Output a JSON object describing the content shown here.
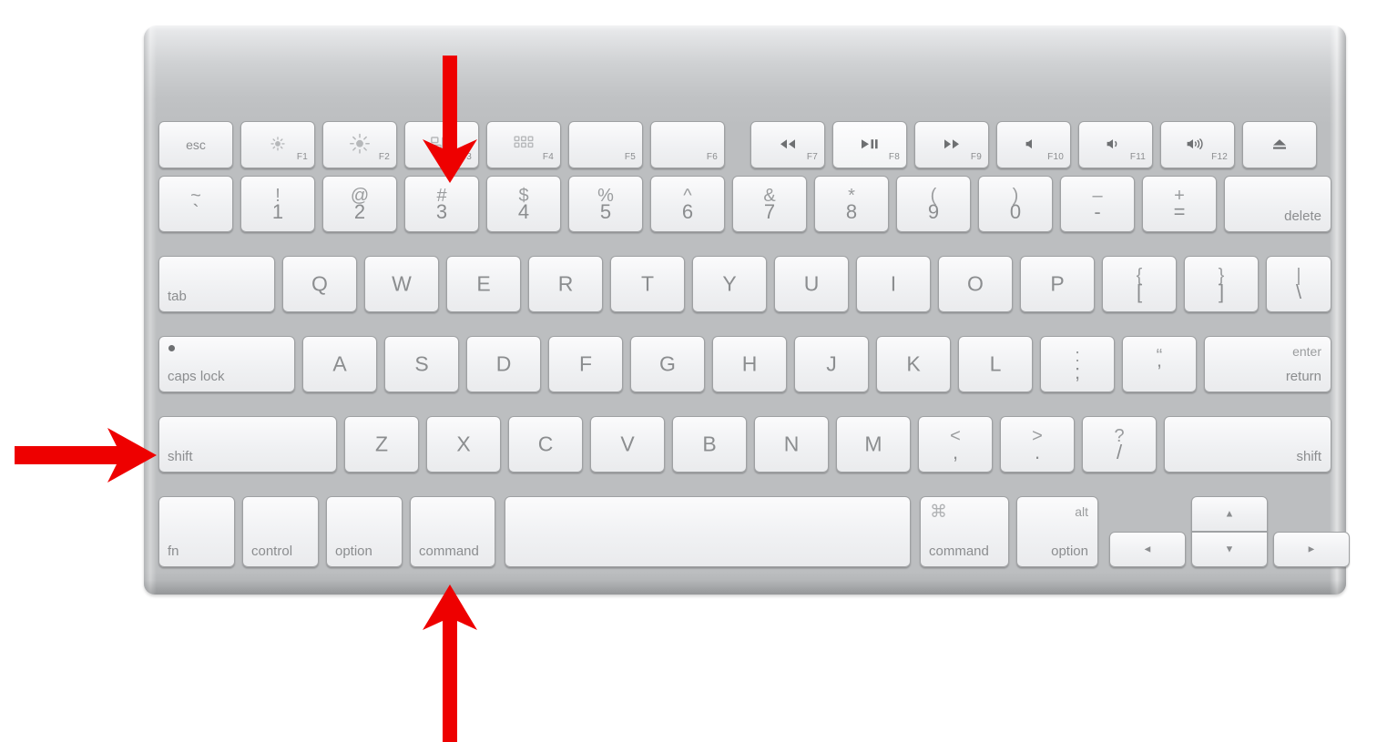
{
  "device": {
    "name": "apple-wireless-keyboard",
    "body_color": "#bcbec0",
    "key_color": "#f2f3f5",
    "legend_color": "#8b8d8f",
    "annotation_color": "#ee0000"
  },
  "rows": {
    "function_row": [
      {
        "name": "esc",
        "label": "esc",
        "kind": "word-center"
      },
      {
        "name": "f1",
        "fkey": "F1",
        "icon": "brightness-down-icon",
        "kind": "fkey"
      },
      {
        "name": "f2",
        "fkey": "F2",
        "icon": "brightness-up-icon",
        "kind": "fkey"
      },
      {
        "name": "f3",
        "fkey": "F3",
        "icon": "mission-control-icon",
        "kind": "fkey"
      },
      {
        "name": "f4",
        "fkey": "F4",
        "icon": "launchpad-icon",
        "kind": "fkey"
      },
      {
        "name": "f5",
        "fkey": "F5",
        "icon": "none",
        "kind": "fkey"
      },
      {
        "name": "f6",
        "fkey": "F6",
        "icon": "none",
        "kind": "fkey"
      },
      {
        "name": "f7",
        "fkey": "F7",
        "icon": "rewind-icon",
        "kind": "fkey"
      },
      {
        "name": "f8",
        "fkey": "F8",
        "icon": "play-pause-icon",
        "kind": "fkey"
      },
      {
        "name": "f9",
        "fkey": "F9",
        "icon": "fast-forward-icon",
        "kind": "fkey"
      },
      {
        "name": "f10",
        "fkey": "F10",
        "icon": "mute-icon",
        "kind": "fkey"
      },
      {
        "name": "f11",
        "fkey": "F11",
        "icon": "volume-down-icon",
        "kind": "fkey"
      },
      {
        "name": "f12",
        "fkey": "F12",
        "icon": "volume-up-icon",
        "kind": "fkey"
      },
      {
        "name": "eject",
        "fkey": "",
        "icon": "eject-icon",
        "kind": "fkey"
      }
    ],
    "number_row": [
      {
        "name": "backtick",
        "upper": "~",
        "lower": "`"
      },
      {
        "name": "one",
        "upper": "!",
        "lower": "1"
      },
      {
        "name": "two",
        "upper": "@",
        "lower": "2"
      },
      {
        "name": "three",
        "upper": "#",
        "lower": "3"
      },
      {
        "name": "four",
        "upper": "$",
        "lower": "4"
      },
      {
        "name": "five",
        "upper": "%",
        "lower": "5"
      },
      {
        "name": "six",
        "upper": "^",
        "lower": "6"
      },
      {
        "name": "seven",
        "upper": "&",
        "lower": "7"
      },
      {
        "name": "eight",
        "upper": "*",
        "lower": "8"
      },
      {
        "name": "nine",
        "upper": "(",
        "lower": "9"
      },
      {
        "name": "zero",
        "upper": ")",
        "lower": "0"
      },
      {
        "name": "minus",
        "upper": "–",
        "lower": "-"
      },
      {
        "name": "equals",
        "upper": "+",
        "lower": "="
      },
      {
        "name": "delete",
        "label": "delete",
        "kind": "word-bottom-right"
      }
    ],
    "top_letter_row": [
      {
        "name": "tab",
        "label": "tab",
        "kind": "word-bottom-left"
      },
      {
        "name": "q",
        "label": "Q"
      },
      {
        "name": "w",
        "label": "W"
      },
      {
        "name": "e",
        "label": "E"
      },
      {
        "name": "r",
        "label": "R"
      },
      {
        "name": "t",
        "label": "T"
      },
      {
        "name": "y",
        "label": "Y"
      },
      {
        "name": "u",
        "label": "U"
      },
      {
        "name": "i",
        "label": "I"
      },
      {
        "name": "o",
        "label": "O"
      },
      {
        "name": "p",
        "label": "P"
      },
      {
        "name": "left-bracket",
        "upper": "{",
        "lower": "["
      },
      {
        "name": "right-bracket",
        "upper": "}",
        "lower": "]"
      },
      {
        "name": "backslash",
        "upper": "|",
        "lower": "\\"
      }
    ],
    "home_row": [
      {
        "name": "caps-lock",
        "label": "caps lock",
        "kind": "word-bottom-left",
        "indicator": true
      },
      {
        "name": "a",
        "label": "A"
      },
      {
        "name": "s",
        "label": "S"
      },
      {
        "name": "d",
        "label": "D"
      },
      {
        "name": "f",
        "label": "F"
      },
      {
        "name": "g",
        "label": "G"
      },
      {
        "name": "h",
        "label": "H"
      },
      {
        "name": "j",
        "label": "J"
      },
      {
        "name": "k",
        "label": "K"
      },
      {
        "name": "l",
        "label": "L"
      },
      {
        "name": "semicolon",
        "upper": ":",
        "lower": ";"
      },
      {
        "name": "quote",
        "upper": "“",
        "lower": "’"
      },
      {
        "name": "return",
        "label_top": "enter",
        "label_bottom": "return",
        "kind": "word-dual-right"
      }
    ],
    "shift_row": [
      {
        "name": "left-shift",
        "label": "shift",
        "kind": "word-bottom-left"
      },
      {
        "name": "z",
        "label": "Z"
      },
      {
        "name": "x",
        "label": "X"
      },
      {
        "name": "c",
        "label": "C"
      },
      {
        "name": "v",
        "label": "V"
      },
      {
        "name": "b",
        "label": "B"
      },
      {
        "name": "n",
        "label": "N"
      },
      {
        "name": "m",
        "label": "M"
      },
      {
        "name": "comma",
        "upper": "<",
        "lower": ","
      },
      {
        "name": "period",
        "upper": ">",
        "lower": "."
      },
      {
        "name": "slash",
        "upper": "?",
        "lower": "/"
      },
      {
        "name": "right-shift",
        "label": "shift",
        "kind": "word-bottom-right"
      }
    ],
    "bottom_row": [
      {
        "name": "fn",
        "label": "fn",
        "kind": "word-bottom-left"
      },
      {
        "name": "left-control",
        "label": "control",
        "kind": "word-bottom-left"
      },
      {
        "name": "left-option",
        "label": "option",
        "kind": "word-bottom-left"
      },
      {
        "name": "left-command",
        "label": "command",
        "kind": "word-bottom-left"
      },
      {
        "name": "space",
        "label": "",
        "kind": "blank"
      },
      {
        "name": "right-command",
        "label": "command",
        "glyph": "⌘",
        "kind": "word-bottom-left-glyph"
      },
      {
        "name": "right-option",
        "label": "option",
        "glyph_top": "alt",
        "kind": "word-bottom-right-top"
      }
    ],
    "arrow_cluster": [
      {
        "name": "arrow-left",
        "label": "◄"
      },
      {
        "name": "arrow-up",
        "label": "▲"
      },
      {
        "name": "arrow-down",
        "label": "▼"
      },
      {
        "name": "arrow-right",
        "label": "►"
      }
    ]
  },
  "annotations": [
    {
      "name": "arrow-pointing-to-key-3",
      "direction": "down",
      "target": "three",
      "color": "#ee0000"
    },
    {
      "name": "arrow-pointing-to-left-shift",
      "direction": "right",
      "target": "left-shift",
      "color": "#ee0000"
    },
    {
      "name": "arrow-pointing-to-left-command",
      "direction": "up",
      "target": "left-command",
      "color": "#ee0000"
    }
  ]
}
